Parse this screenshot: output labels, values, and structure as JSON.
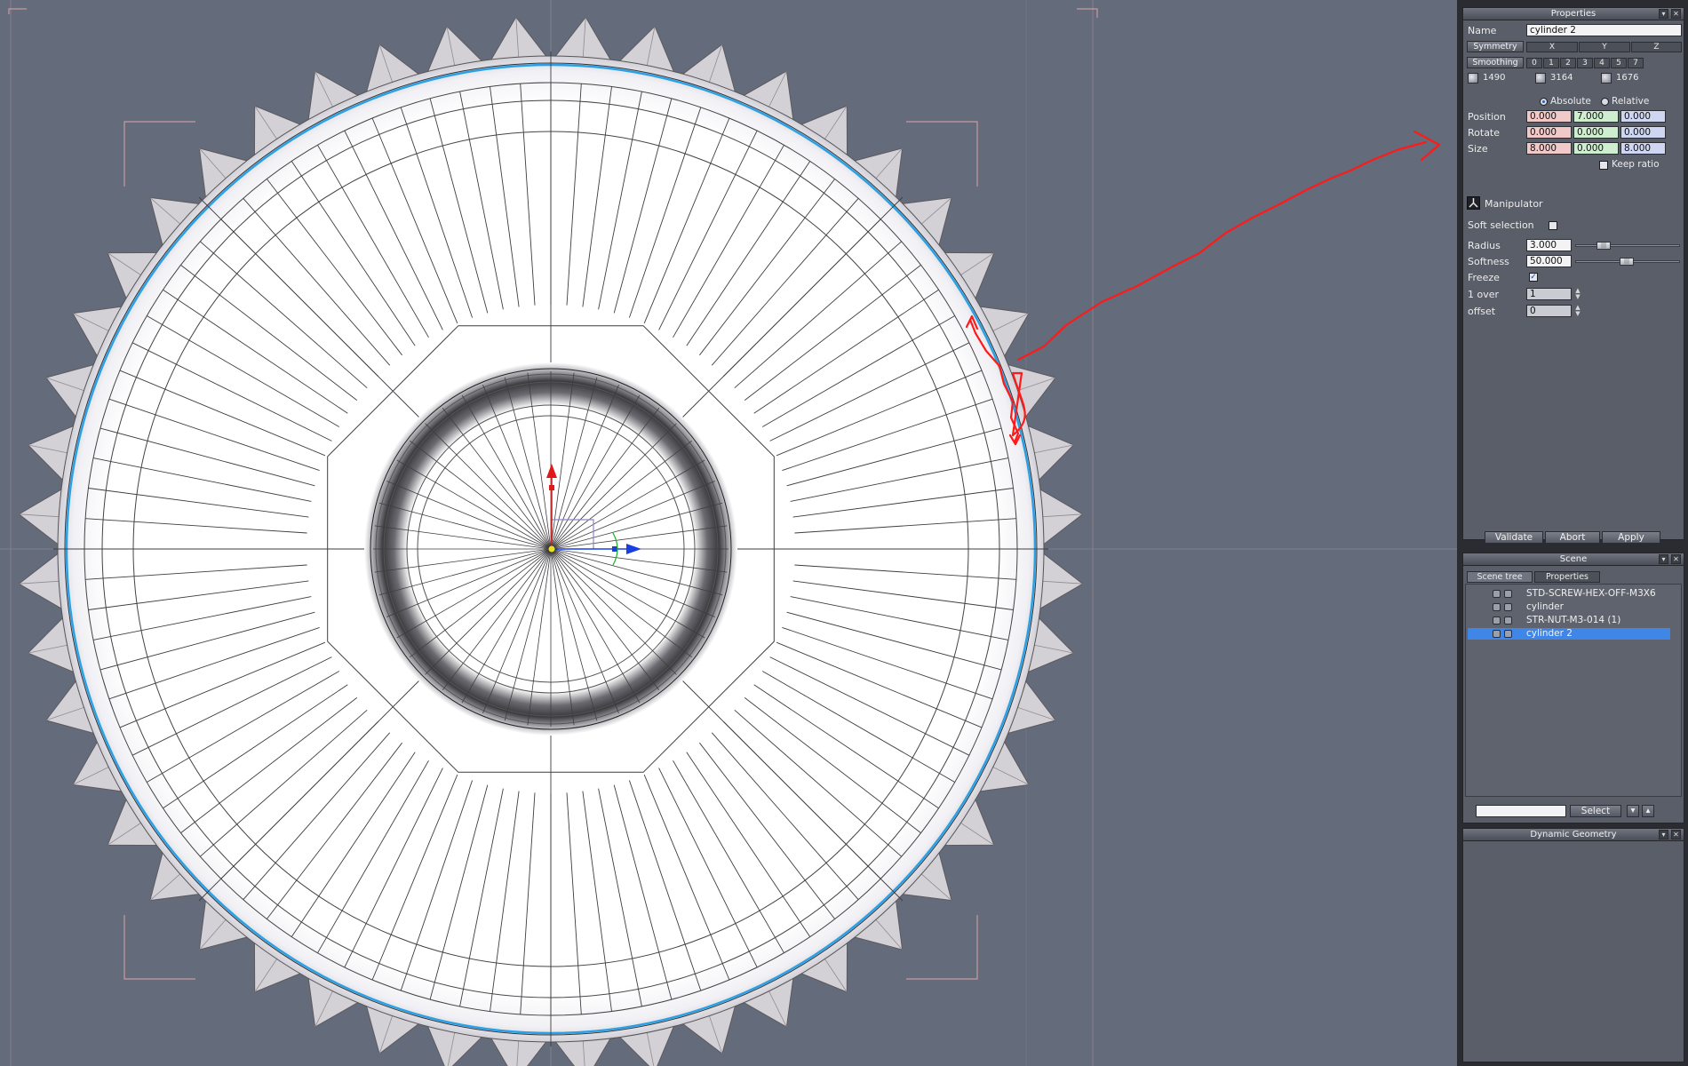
{
  "properties_panel": {
    "title": "Properties",
    "name_label": "Name",
    "name_value": "cylinder 2",
    "symmetry_label": "Symmetry",
    "axes": [
      "X",
      "Y",
      "Z"
    ],
    "smoothing_label": "Smoothing",
    "smoothing_levels": [
      "0",
      "1",
      "2",
      "3",
      "4",
      "5",
      "7"
    ],
    "stats": [
      "1490",
      "3164",
      "1676"
    ],
    "absolute_label": "Absolute",
    "relative_label": "Relative",
    "mode_selected": "Absolute",
    "position_label": "Position",
    "position": [
      "0.000",
      "7.000",
      "0.000"
    ],
    "rotate_label": "Rotate",
    "rotate": [
      "0.000",
      "0.000",
      "0.000"
    ],
    "size_label": "Size",
    "size": [
      "8.000",
      "0.000",
      "8.000"
    ],
    "keep_ratio_label": "Keep ratio",
    "keep_ratio_checked": false,
    "manipulator_label": "Manipulator",
    "soft_selection_label": "Soft selection",
    "soft_selection_checked": false,
    "radius_label": "Radius",
    "radius_value": "3.000",
    "softness_label": "Softness",
    "softness_value": "50.000",
    "freeze_label": "Freeze",
    "freeze_checked": true,
    "one_over_label": "1 over",
    "one_over_value": "1",
    "offset_label": "offset",
    "offset_value": "0",
    "validate_label": "Validate",
    "abort_label": "Abort",
    "apply_label": "Apply"
  },
  "scene_panel": {
    "title": "Scene",
    "tabs": [
      "Scene tree",
      "Properties"
    ],
    "active_tab": "Scene tree",
    "items": [
      {
        "label": "STD-SCREW-HEX-OFF-M3X6",
        "selected": false
      },
      {
        "label": "cylinder",
        "selected": false
      },
      {
        "label": "STR-NUT-M3-014 (1)",
        "selected": false
      },
      {
        "label": "cylinder 2",
        "selected": true
      }
    ],
    "search_value": "",
    "select_label": "Select"
  },
  "dynamic_geometry_panel": {
    "title": "Dynamic Geometry"
  },
  "colors": {
    "viewport_bg": "#646b7a",
    "panel_bg": "#5a5e68",
    "selection_blue": "#3f86e6",
    "annotation_red": "#ff1a1a",
    "highlight_ring": "#2aa0e6"
  }
}
